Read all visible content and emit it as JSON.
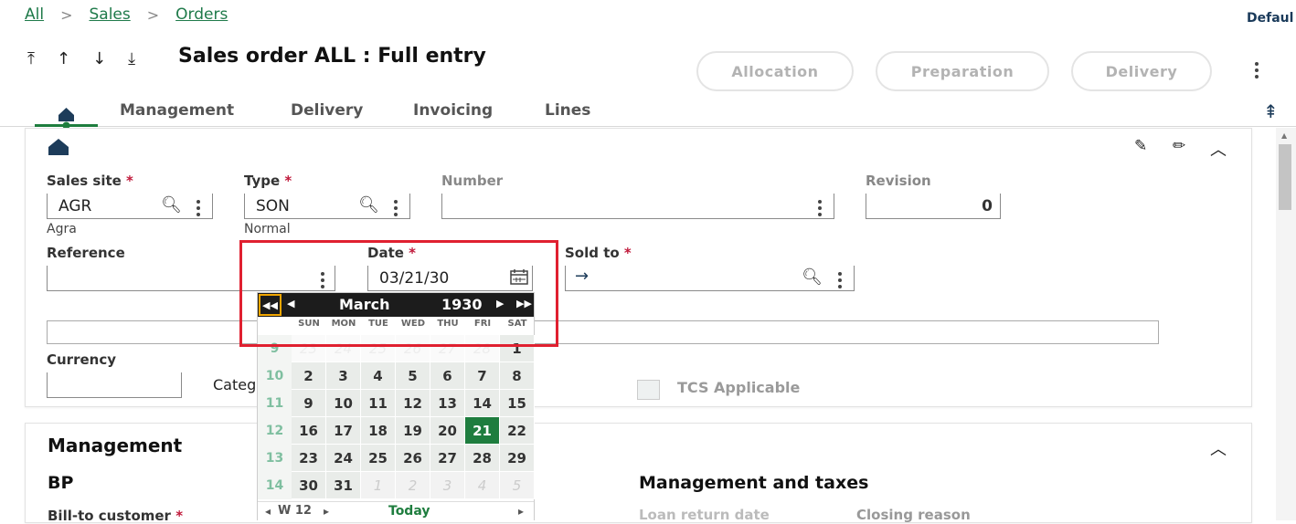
{
  "breadcrumb": [
    "All",
    "Sales",
    "Orders"
  ],
  "top_right_label": "Defaul",
  "title": "Sales order ALL : Full entry",
  "actions": [
    "Allocation",
    "Preparation",
    "Delivery"
  ],
  "tabs": [
    "Management",
    "Delivery",
    "Invoicing",
    "Lines"
  ],
  "header": {
    "sales_site": {
      "label": "Sales site",
      "value": "AGR",
      "desc": "Agra"
    },
    "type": {
      "label": "Type",
      "value": "SON",
      "desc": "Normal"
    },
    "number": {
      "label": "Number",
      "value": ""
    },
    "revision": {
      "label": "Revision",
      "value": "0"
    },
    "reference": {
      "label": "Reference",
      "value": ""
    },
    "date": {
      "label": "Date",
      "value": "03/21/30"
    },
    "sold_to": {
      "label": "Sold to",
      "value": ""
    },
    "currency": {
      "label": "Currency",
      "value": ""
    },
    "category_partial": "Categ",
    "tcs": {
      "label": "TCS Applicable"
    }
  },
  "calendar": {
    "month": "March",
    "year": "1930",
    "weekdays": [
      "SUN",
      "MON",
      "TUE",
      "WED",
      "THU",
      "FRI",
      "SAT"
    ],
    "weeks": [
      {
        "wk": "9",
        "days": [
          "23",
          "24",
          "25",
          "26",
          "27",
          "28",
          "1"
        ]
      },
      {
        "wk": "10",
        "days": [
          "2",
          "3",
          "4",
          "5",
          "6",
          "7",
          "8"
        ]
      },
      {
        "wk": "11",
        "days": [
          "9",
          "10",
          "11",
          "12",
          "13",
          "14",
          "15"
        ]
      },
      {
        "wk": "12",
        "days": [
          "16",
          "17",
          "18",
          "19",
          "20",
          "21",
          "22"
        ]
      },
      {
        "wk": "13",
        "days": [
          "23",
          "24",
          "25",
          "26",
          "27",
          "28",
          "29"
        ]
      },
      {
        "wk": "14",
        "days": [
          "30",
          "31",
          "1",
          "2",
          "3",
          "4",
          "5"
        ]
      }
    ],
    "selected_day": "21",
    "footer_week": "W 12",
    "today_label": "Today"
  },
  "management": {
    "title": "Management",
    "bp": "BP",
    "bill_to": "Bill-to customer",
    "taxes_title": "Management and taxes",
    "loan_return": "Loan return date",
    "closing_reason": "Closing reason"
  },
  "colors": {
    "accent": "#1e7d3e",
    "highlight": "#e02030",
    "focus": "#f0a500"
  }
}
